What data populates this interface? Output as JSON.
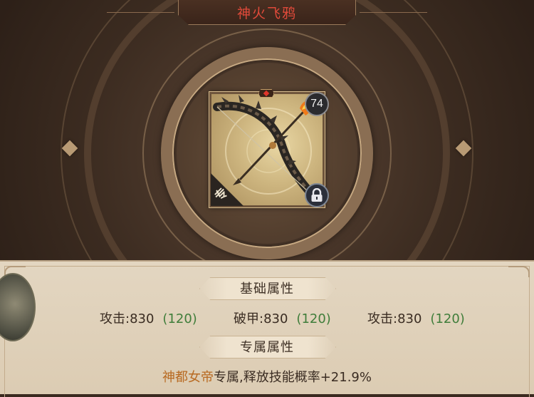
{
  "title": "神火飞鸦",
  "item": {
    "level": "74",
    "exclusive_tag": "专",
    "icons": {
      "lock": "lock-icon",
      "gem": "gem-icon",
      "weapon": "bow-icon"
    }
  },
  "base_section": {
    "header": "基础属性",
    "stats": [
      {
        "label": "攻击:830",
        "bonus": "(120)"
      },
      {
        "label": "破甲:830",
        "bonus": "(120)"
      },
      {
        "label": "攻击:830",
        "bonus": "(120)"
      }
    ]
  },
  "exclusive_section": {
    "header": "专属属性",
    "hero": "神都女帝",
    "effect": "专属,释放技能概率+21.9%"
  },
  "colors": {
    "title": "#e04a3a",
    "bonus": "#3f7d3a",
    "hero": "#b86a22",
    "panel": "#e3d6c1"
  }
}
